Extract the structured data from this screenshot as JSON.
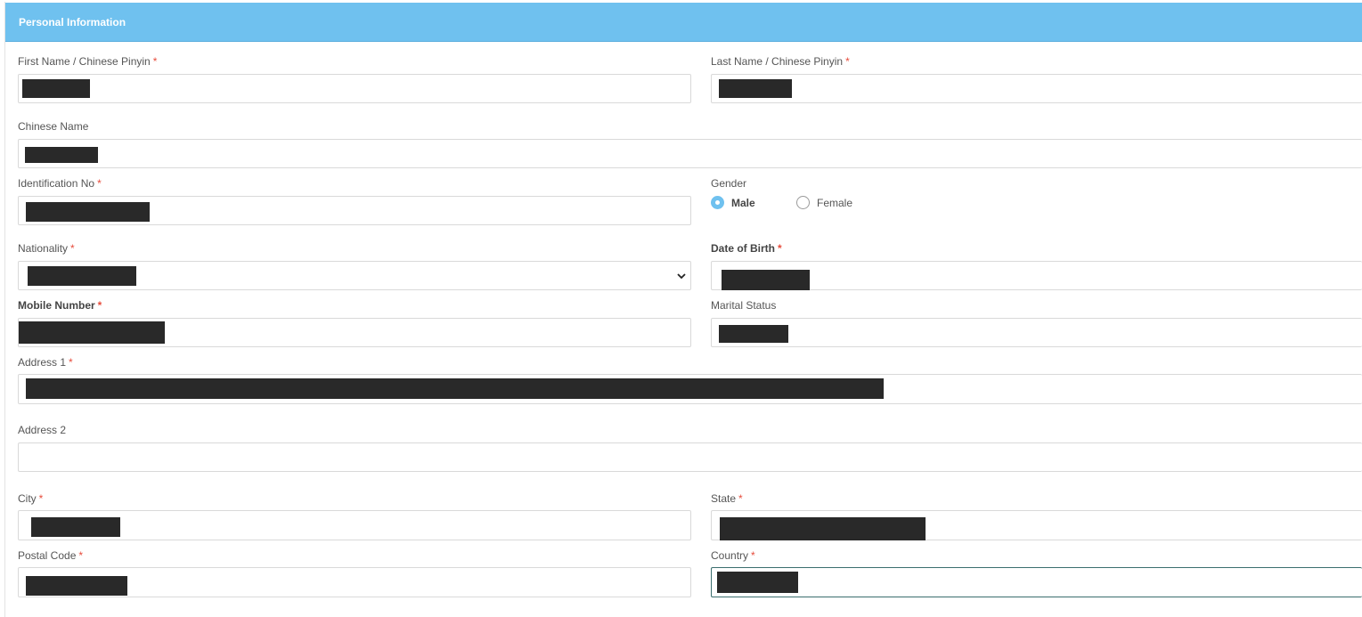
{
  "section": {
    "title": "Personal Information"
  },
  "required_marker": "*",
  "fields": {
    "first_name": {
      "label": "First Name / Chinese Pinyin"
    },
    "last_name": {
      "label": "Last Name / Chinese Pinyin"
    },
    "chinese_name": {
      "label": "Chinese Name"
    },
    "identification_no": {
      "label": "Identification No"
    },
    "gender": {
      "label": "Gender",
      "options": [
        "Male",
        "Female"
      ],
      "selected": "Male"
    },
    "nationality": {
      "label": "Nationality"
    },
    "date_of_birth": {
      "label": "Date of Birth"
    },
    "mobile_number": {
      "label": "Mobile Number"
    },
    "marital_status": {
      "label": "Marital Status"
    },
    "address1": {
      "label": "Address 1"
    },
    "address2": {
      "label": "Address 2",
      "value": ""
    },
    "city": {
      "label": "City"
    },
    "state": {
      "label": "State"
    },
    "postal_code": {
      "label": "Postal Code"
    },
    "country": {
      "label": "Country"
    }
  },
  "icons": {
    "select_arrow": "chevron-down-icon"
  },
  "colors": {
    "header": "#6fc1ef",
    "required": "#e74c3c",
    "redaction": "#292929"
  }
}
